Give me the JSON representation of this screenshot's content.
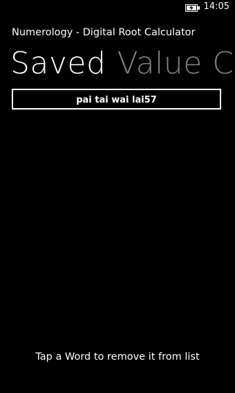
{
  "status_bar": {
    "battery_icon": "battery-charging-icon",
    "time": "14:05"
  },
  "app": {
    "title": "Numerology - Digital Root Calculator"
  },
  "pivot": {
    "headers": [
      "Saved",
      "Value Ch"
    ],
    "active_index": 0
  },
  "saved_words": [
    "pai tai wai lai57"
  ],
  "hint": "Tap a Word to remove it from list",
  "colors": {
    "background": "#000000",
    "foreground": "#ffffff",
    "inactive_header": "#808080"
  }
}
